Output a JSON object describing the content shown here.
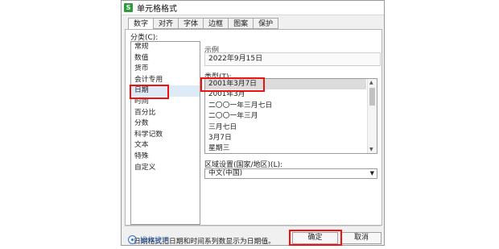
{
  "window": {
    "title": "单元格格式",
    "app_icon": "S"
  },
  "tabs": [
    "数字",
    "对齐",
    "字体",
    "边框",
    "图案",
    "保护"
  ],
  "active_tab": 0,
  "category": {
    "label": "分类(C):",
    "items": [
      "常规",
      "数值",
      "货币",
      "会计专用",
      "日期",
      "时间",
      "百分比",
      "分数",
      "科学记数",
      "文本",
      "特殊",
      "自定义"
    ],
    "selected": "日期"
  },
  "sample": {
    "label": "示例",
    "value": "2022年9月15日"
  },
  "type": {
    "label": "类型(T):",
    "items": [
      "2001年3月7日",
      "2001年3月",
      "二〇〇一年三月七日",
      "二〇〇一年三月",
      "三月七日",
      "3月7日",
      "星期三"
    ],
    "selected": "2001年3月7日"
  },
  "region": {
    "label": "区域设置(国家/地区)(L):",
    "value": "中文(中国)"
  },
  "description": "日期格式把日期和时间系列数显示为日期值。",
  "footer": {
    "help_label": "操作技巧",
    "ok_label": "确定",
    "cancel_label": "取消"
  },
  "colors": {
    "highlight": "#ee1111",
    "accent": "#3b73c8",
    "app_icon": "#2a9d3a"
  }
}
